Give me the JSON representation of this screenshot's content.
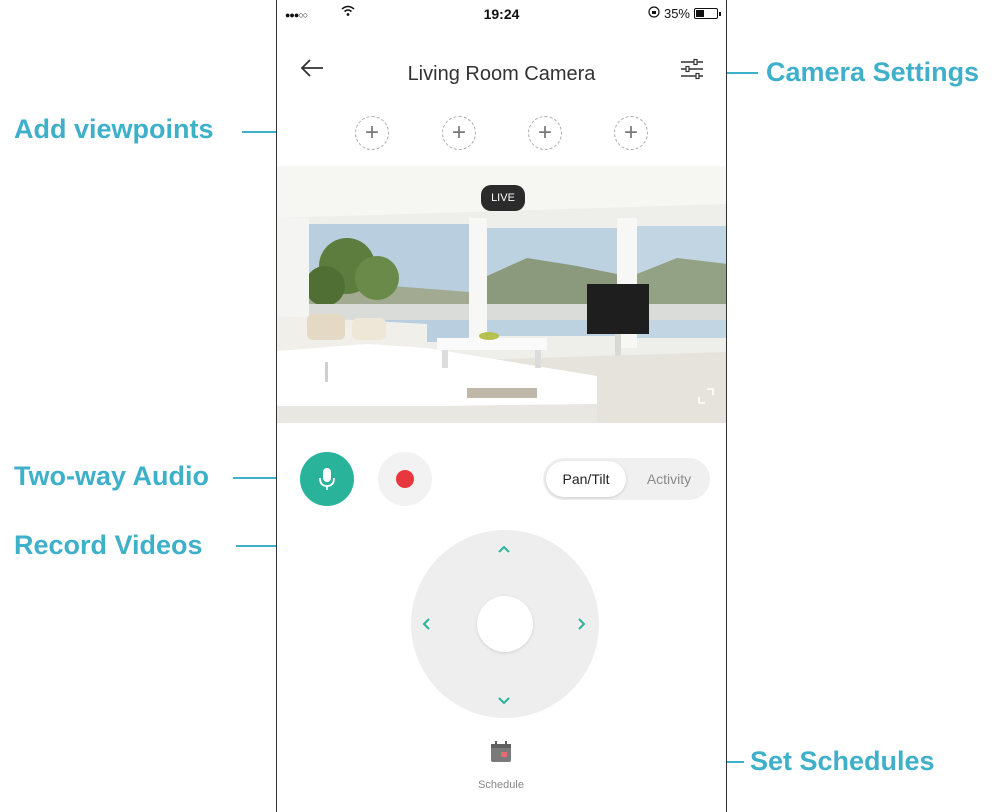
{
  "status_bar": {
    "time": "19:24",
    "battery": "35%"
  },
  "header": {
    "back_icon": "arrow-left-icon",
    "title": "Living Room Camera",
    "settings_icon": "sliders-icon"
  },
  "viewpoints": {
    "count": 4,
    "add_symbol": "+"
  },
  "video": {
    "badge": "LIVE"
  },
  "controls": {
    "mic_icon": "microphone-icon",
    "record_icon": "record-dot-icon"
  },
  "mode_tabs": [
    {
      "label": "Pan/Tilt",
      "active": true
    },
    {
      "label": "Activity",
      "active": false
    }
  ],
  "joystick": {
    "up": "^",
    "down": "v",
    "left": "<",
    "right": ">"
  },
  "bottom": {
    "schedule_label": "Schedule"
  },
  "callouts": {
    "add_viewpoints": "Add viewpoints",
    "camera_settings": "Camera Settings",
    "two_way_audio": "Two-way Audio",
    "record_videos": "Record Videos",
    "set_schedules": "Set Schedules"
  },
  "colors": {
    "accent": "#2ab39b",
    "callout": "#3fb0c9",
    "record": "#e8383d"
  }
}
